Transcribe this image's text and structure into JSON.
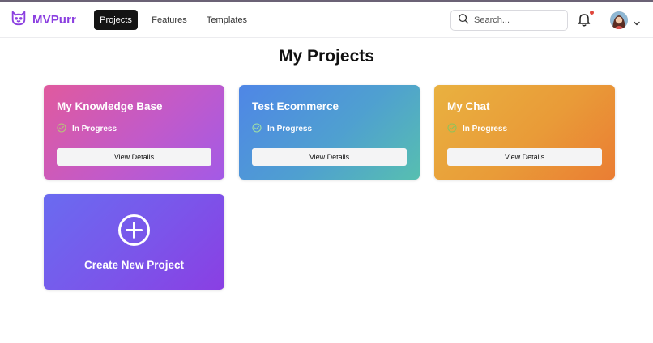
{
  "brand": {
    "name": "MVPurr",
    "logo_icon": "cat-icon",
    "color": "#8b3fe0"
  },
  "nav": {
    "items": [
      {
        "label": "Projects",
        "active": true
      },
      {
        "label": "Features",
        "active": false
      },
      {
        "label": "Templates",
        "active": false
      }
    ]
  },
  "search": {
    "placeholder": "Search...",
    "value": "",
    "icon": "search-icon"
  },
  "notifications": {
    "icon": "bell-icon",
    "has_unread": true,
    "dot_color": "#e0473c"
  },
  "user": {
    "avatar_icon": "avatar",
    "menu_icon": "chevron-down-icon"
  },
  "page": {
    "title": "My Projects"
  },
  "projects": [
    {
      "title": "My Knowledge Base",
      "status": "In Progress",
      "action": "View Details",
      "gradient": [
        "#e05a9e",
        "#a35ae6"
      ]
    },
    {
      "title": "Test Ecommerce",
      "status": "In Progress",
      "action": "View Details",
      "gradient": [
        "#4f86e6",
        "#57bfb0"
      ]
    },
    {
      "title": "My Chat",
      "status": "In Progress",
      "action": "View Details",
      "gradient": [
        "#e9b140",
        "#ea7d33"
      ]
    }
  ],
  "create": {
    "label": "Create New Project",
    "icon": "plus-circle-icon",
    "gradient": [
      "#6a6bf0",
      "#8a3fe3"
    ]
  }
}
